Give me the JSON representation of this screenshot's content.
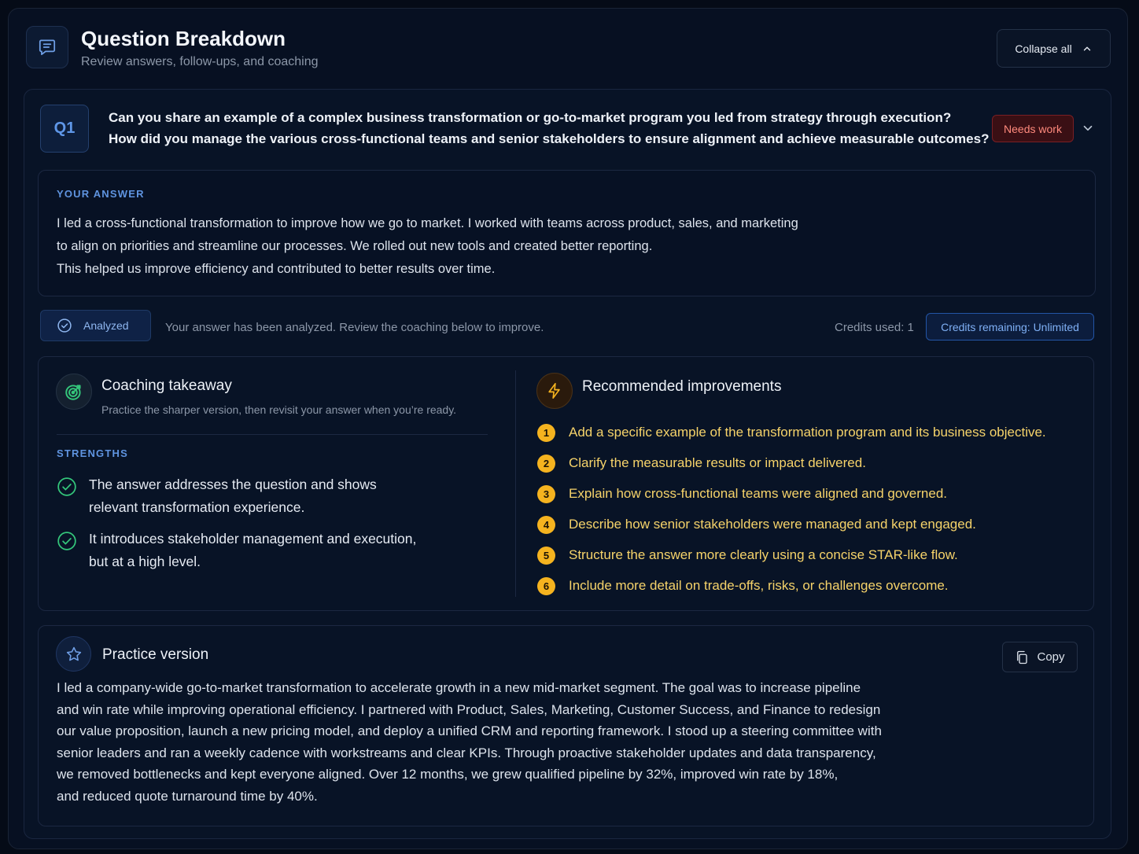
{
  "header": {
    "title": "Question Breakdown",
    "subtitle": "Review answers, follow-ups, and coaching",
    "collapse_label": "Collapse all"
  },
  "question": {
    "badge": "Q1",
    "lines": [
      "Can you share an example of a complex business transformation or go-to-market program you led from strategy through execution?",
      "How did you manage the various cross-functional teams and senior stakeholders to ensure alignment and achieve measurable outcomes?"
    ],
    "status": "Needs work",
    "status_color": "#ff8a7d"
  },
  "answer": {
    "label": "YOUR ANSWER",
    "lines": [
      "I led a cross-functional transformation to improve how we go to market. I worked with teams across product, sales, and marketing",
      "to align on priorities and streamline our processes. We rolled out new tools and created better reporting.",
      "This helped us improve efficiency and contributed to better results over time."
    ]
  },
  "analysis": {
    "status_label": "Analyzed",
    "message": "Your answer has been analyzed. Review the coaching below to improve.",
    "credits_used": "Credits used: 1",
    "credits_remaining": "Credits remaining: Unlimited"
  },
  "coaching": {
    "title": "Coaching takeaway",
    "subtitle": "Practice the sharper version, then revisit your answer when you’re ready.",
    "strengths_label": "STRENGTHS",
    "strengths": [
      {
        "lines": [
          "The answer addresses the question and shows",
          "relevant transformation experience."
        ]
      },
      {
        "lines": [
          "It introduces stakeholder management and execution,",
          "but at a high level."
        ]
      }
    ]
  },
  "improvements": {
    "title": "Recommended improvements",
    "accent": "#f5b31f",
    "items": [
      {
        "num": "1",
        "text": "Add a specific example of the transformation program and its business objective."
      },
      {
        "num": "2",
        "text": "Clarify the measurable results or impact delivered."
      },
      {
        "num": "3",
        "text": "Explain how cross-functional teams were aligned and governed."
      },
      {
        "num": "4",
        "text": "Describe how senior stakeholders were managed and kept engaged."
      },
      {
        "num": "5",
        "text": "Structure the answer more clearly using a concise STAR-like flow."
      },
      {
        "num": "6",
        "text": "Include more detail on trade-offs, risks, or challenges overcome."
      }
    ]
  },
  "practice": {
    "title": "Practice version",
    "copy_label": "Copy",
    "lines": [
      "I led a company-wide go-to-market transformation to accelerate growth in a new mid-market segment. The goal was to increase pipeline",
      "and win rate while improving operational efficiency. I partnered with Product, Sales, Marketing, Customer Success, and Finance to redesign",
      "our value proposition, launch a new pricing model, and deploy a unified CRM and reporting framework. I stood up a steering committee with",
      "senior leaders and ran a weekly cadence with workstreams and clear KPIs. Through proactive stakeholder updates and data transparency,",
      "we removed bottlenecks and kept everyone aligned. Over 12 months, we grew qualified pipeline by 32%, improved win rate by 18%,",
      "and reduced quote turnaround time by 40%."
    ]
  }
}
